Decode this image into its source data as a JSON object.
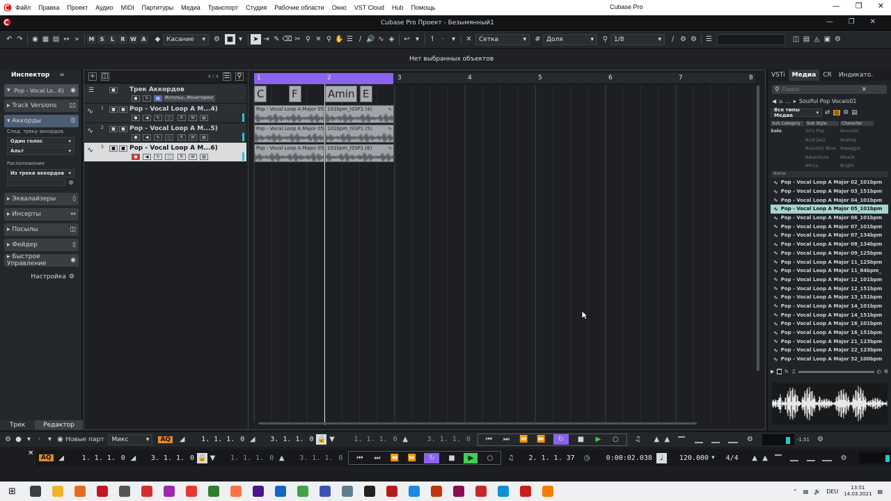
{
  "os_menu": [
    "Файл",
    "Правка",
    "Проект",
    "Аудио",
    "MIDI",
    "Партитуры",
    "Медиа",
    "Транспорт",
    "Студия",
    "Рабочие области",
    "Окно",
    "VST Cloud",
    "Hub",
    "Помощь"
  ],
  "os_title": "Cubase Pro",
  "project_title": "Cubase Pro Проект - Безымянный1",
  "toolbar": {
    "mode_buttons": [
      "M",
      "S",
      "L",
      "R",
      "W",
      "A"
    ],
    "automation_mode": "Касание",
    "grid_type": "Сетка",
    "grid_unit": "Доля",
    "quantize": "1/8"
  },
  "info_line": "Нет выбранных объектов",
  "inspector": {
    "tabs": [
      "Инспектор",
      "="
    ],
    "track_label": "Pop - Vocal Lo...6)",
    "sections": [
      "Track Versions",
      "Аккорды"
    ],
    "follow_label": "След. треку аккордов",
    "voicing_value": "Один голос",
    "voicing2_value": "Альт",
    "arrangement_label": "Расположение",
    "arrangement_value": "Из трека аккордов",
    "more_sections": [
      "Эквалайзеры",
      "Инсерты",
      "Посылы",
      "Фейдер",
      "Быстрое Управление"
    ],
    "settings_label": "Настройка",
    "bottom_tabs": [
      "Трек",
      "Редактор"
    ]
  },
  "tracklist": {
    "count": "4 / 4",
    "chord_track_name": "Трек Аккордов",
    "chord_track_sub": "Использ...Мониторинг",
    "tracks": [
      {
        "num": "1",
        "name": "Pop - Vocal Loop A M...4)"
      },
      {
        "num": "2",
        "name": "Pop - Vocal Loop A M...5)"
      },
      {
        "num": "3",
        "name": "Pop - Vocal Loop A M...6)"
      }
    ]
  },
  "arrange": {
    "bars": [
      "1",
      "2",
      "3",
      "4",
      "5",
      "6",
      "7",
      "8"
    ],
    "chords": [
      "C",
      "F",
      "Amin",
      "E"
    ],
    "clips": [
      [
        "Pop - Vocal Loop A Major 05",
        "101bpm_ISSP1 (4)"
      ],
      [
        "Pop - Vocal Loop A Major 05",
        "101bpm_ISSP1 (5)"
      ],
      [
        "Pop - Vocal Loop A Major 05",
        "101bpm_ISSP1 (6)"
      ]
    ]
  },
  "mediabay": {
    "tabs": [
      "VSTi",
      "Медиа",
      "CR",
      "Индикато."
    ],
    "search_placeholder": "Поиск",
    "path_prefix": "...",
    "path": "Soulful Pop Vocals01",
    "filter": "Все типы Медиа",
    "columns": [
      "Sub Category",
      "Sub Style",
      "Character"
    ],
    "col1": [
      "Solo"
    ],
    "col2": [
      "50's Pop",
      "Acid Jazz",
      "Acoustic Blue",
      "Adventure",
      "Africa"
    ],
    "col3": [
      "Acoustic",
      "Analog",
      "Arpeggio",
      "Attack",
      "Bright"
    ],
    "name_header": "Name",
    "results": [
      "Pop - Vocal Loop A Major 02_101bpm",
      "Pop - Vocal Loop A Major 03_151bpm",
      "Pop - Vocal Loop A Major 04_101bpm",
      "Pop - Vocal Loop A Major 05_101bpm",
      "Pop - Vocal Loop A Major 06_101bpm",
      "Pop - Vocal Loop A Major 07_101bpm",
      "Pop - Vocal Loop A Major 07_134bpm",
      "Pop - Vocal Loop A Major 08_134bpm",
      "Pop - Vocal Loop A Major 09_125bpm",
      "Pop - Vocal Loop A Major 11_125bpm",
      "Pop - Vocal Loop A Major 11_84bpm_",
      "Pop - Vocal Loop A Major 12_101bpm",
      "Pop - Vocal Loop A Major 12_151bpm",
      "Pop - Vocal Loop A Major 13_151bpm",
      "Pop - Vocal Loop A Major 14_101bpm",
      "Pop - Vocal Loop A Major 14_151bpm",
      "Pop - Vocal Loop A Major 16_101bpm",
      "Pop - Vocal Loop A Major 16_151bpm",
      "Pop - Vocal Loop A Major 21_123bpm",
      "Pop - Vocal Loop A Major 22_123bpm",
      "Pop - Vocal Loop A Major 32_100bpm"
    ],
    "selected_index": 3
  },
  "transport1": {
    "new_parts": "Новые парт",
    "mix": "Микс",
    "aq": "AQ",
    "pos1": "1. 1. 1.",
    "pos1b": "0",
    "pos2": "3. 1. 1.",
    "pos2b": "0",
    "pos3": "1. 1. 1.",
    "pos3b": "0",
    "pos4": "3. 1. 1.",
    "pos4b": "0",
    "meter": "-1.51"
  },
  "transport2": {
    "aq": "AQ",
    "pos1": "1. 1. 1.",
    "pos1b": "0",
    "pos2": "3. 1. 1.",
    "pos2b": "0",
    "pos3": "1. 1. 1.",
    "pos3b": "0",
    "pos4": "3. 1. 1.",
    "pos4b": "0",
    "primary_pos": "2. 1. 1. 37",
    "time": "0:00:02.038",
    "tempo": "120.000",
    "signature": "4/4"
  },
  "taskbar": {
    "lang": "DEU",
    "time": "13:51",
    "date": "14.03.2021"
  },
  "colors": {
    "accent_purple": "#8a63f0",
    "play_green": "#3ccf55",
    "aq_orange": "#e38d2a",
    "meter_cyan": "#26c6da"
  }
}
